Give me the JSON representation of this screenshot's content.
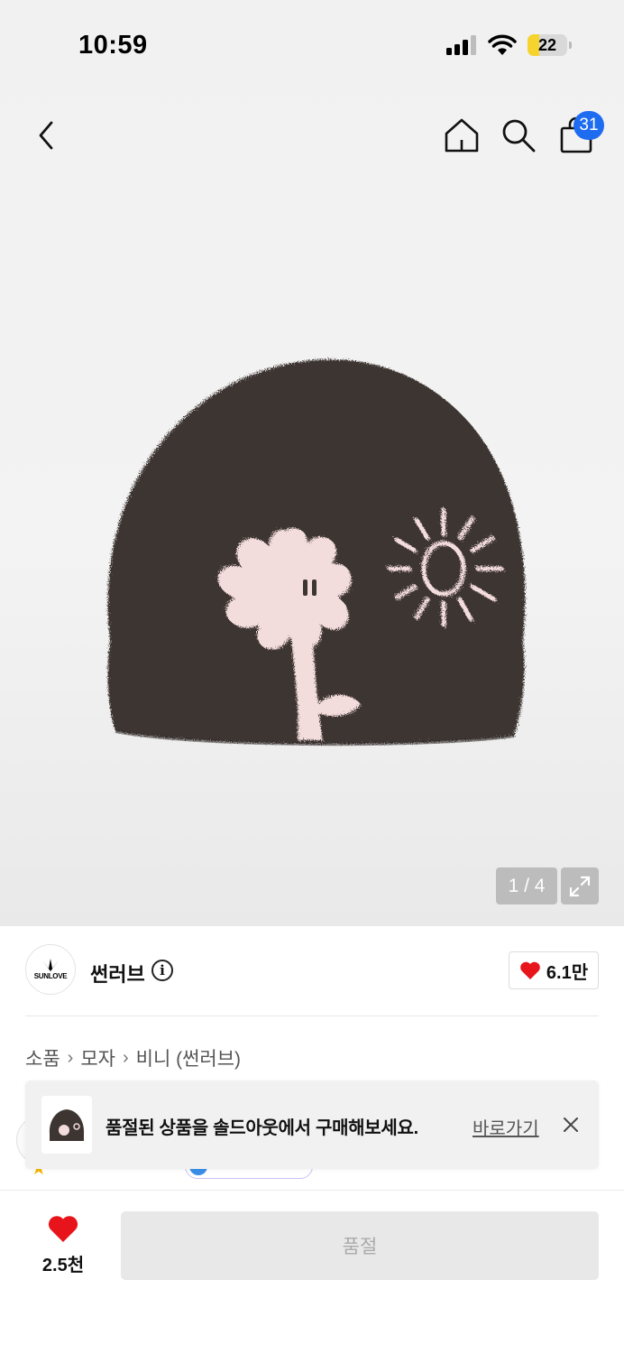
{
  "status_bar": {
    "time": "10:59",
    "battery": "22"
  },
  "header": {
    "cart_count": "31"
  },
  "gallery": {
    "counter": "1 / 4"
  },
  "brand": {
    "name": "썬러브",
    "logo_text": "SUNLOVE",
    "like_count": "6.1만"
  },
  "breadcrumb": [
    "소품",
    "모자",
    "비니 (썬러브)"
  ],
  "toast": {
    "message": "품절된 상품을 솔드아웃에서 구매해보세요.",
    "link_label": "바로가기"
  },
  "bottom_bar": {
    "like_count": "2.5천",
    "soldout_label": "품절"
  },
  "colors": {
    "accent_blue": "#1e6cf0",
    "heart_red": "#e8141b",
    "beanie_brown": "#3d3532",
    "flower_pink": "#f3dcdc"
  }
}
